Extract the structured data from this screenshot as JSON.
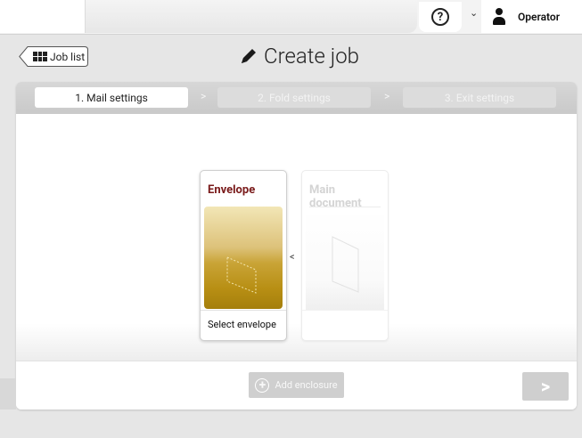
{
  "topbar": {
    "help_symbol": "?",
    "dropdown_symbol": "⌄",
    "user_label": "Operator"
  },
  "header": {
    "joblist_label": "Job list",
    "title": "Create job"
  },
  "steps": [
    {
      "label": "1. Mail settings",
      "state": "active"
    },
    {
      "label": "2. Fold settings",
      "state": "inactive"
    },
    {
      "label": "3. Exit settings",
      "state": "inactive"
    }
  ],
  "step_separator": ">",
  "cards": {
    "envelope": {
      "title": "Envelope",
      "footer": "Select envelope"
    },
    "main_document": {
      "title": "Main document",
      "footer": ""
    },
    "insert_arrow": "<"
  },
  "bottom": {
    "add_enclosure_label": "Add enclosure",
    "next_symbol": ">"
  },
  "colors": {
    "accent_title": "#7a1b1b",
    "envelope_gold": "#b88f14",
    "disabled_button": "#cfcfcf"
  }
}
